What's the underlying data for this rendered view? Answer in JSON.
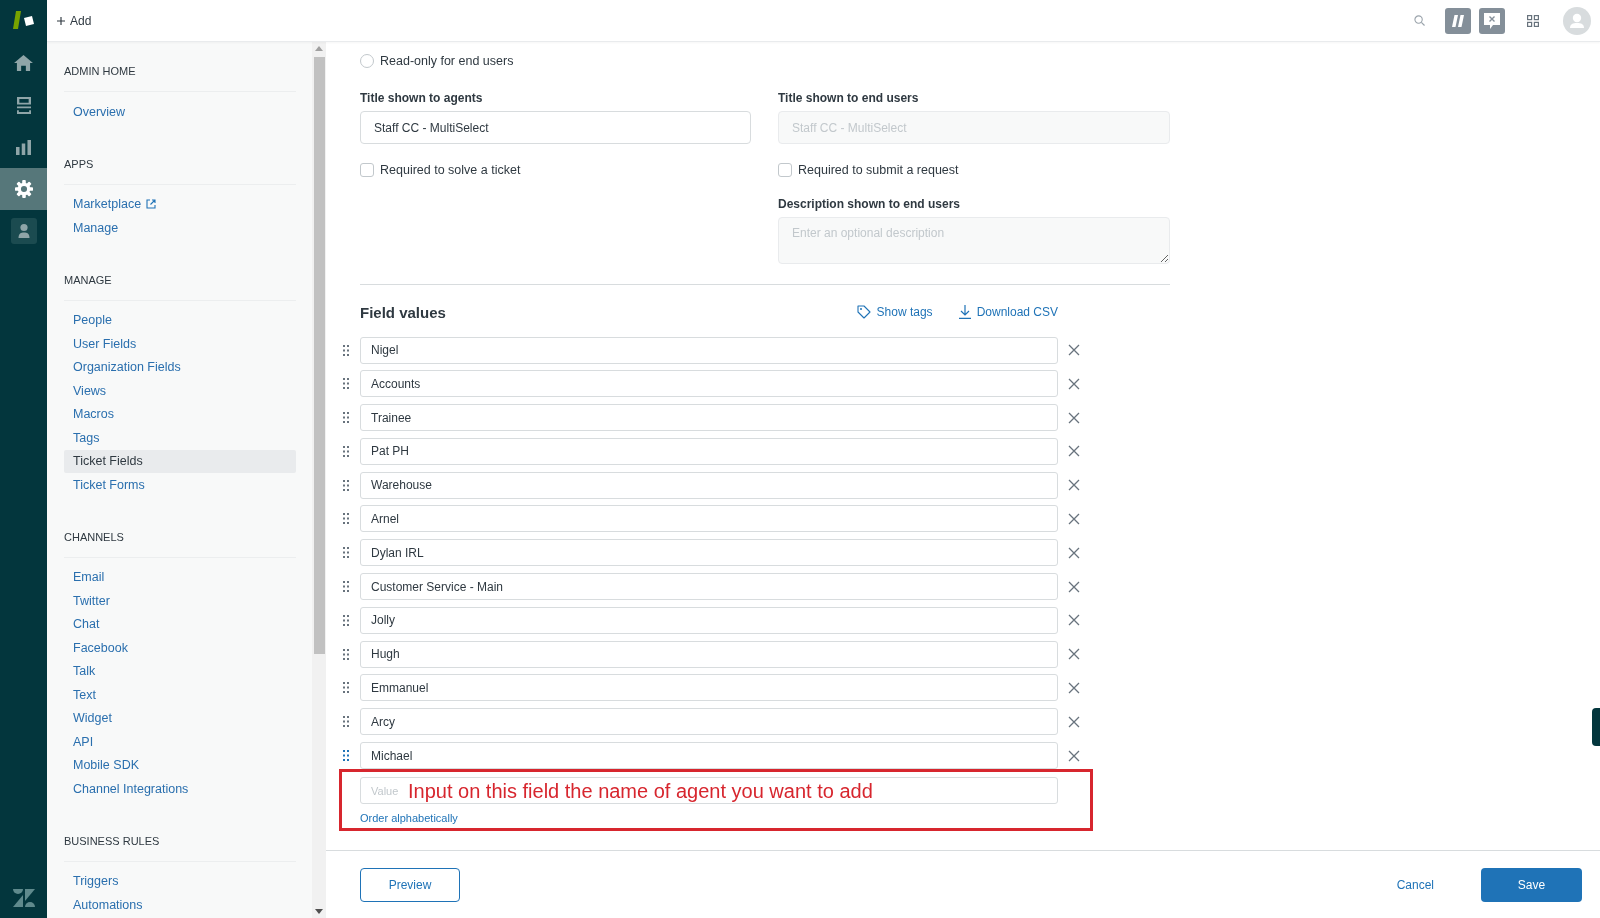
{
  "nav_rail": [
    {
      "selected": false
    },
    {
      "selected": false
    },
    {
      "selected": false
    },
    {
      "selected": true
    },
    {
      "selected": false
    }
  ],
  "top_bar": {
    "add_label": "Add"
  },
  "sidebar": {
    "sections": [
      {
        "title": "ADMIN HOME",
        "items": [
          {
            "label": "Overview",
            "selected": false,
            "external": false
          }
        ]
      },
      {
        "title": "APPS",
        "items": [
          {
            "label": "Marketplace",
            "selected": false,
            "external": true
          },
          {
            "label": "Manage",
            "selected": false,
            "external": false
          }
        ]
      },
      {
        "title": "MANAGE",
        "items": [
          {
            "label": "People",
            "selected": false,
            "external": false
          },
          {
            "label": "User Fields",
            "selected": false,
            "external": false
          },
          {
            "label": "Organization Fields",
            "selected": false,
            "external": false
          },
          {
            "label": "Views",
            "selected": false,
            "external": false
          },
          {
            "label": "Macros",
            "selected": false,
            "external": false
          },
          {
            "label": "Tags",
            "selected": false,
            "external": false
          },
          {
            "label": "Ticket Fields",
            "selected": true,
            "external": false
          },
          {
            "label": "Ticket Forms",
            "selected": false,
            "external": false
          }
        ]
      },
      {
        "title": "CHANNELS",
        "items": [
          {
            "label": "Email",
            "selected": false,
            "external": false
          },
          {
            "label": "Twitter",
            "selected": false,
            "external": false
          },
          {
            "label": "Chat",
            "selected": false,
            "external": false
          },
          {
            "label": "Facebook",
            "selected": false,
            "external": false
          },
          {
            "label": "Talk",
            "selected": false,
            "external": false
          },
          {
            "label": "Text",
            "selected": false,
            "external": false
          },
          {
            "label": "Widget",
            "selected": false,
            "external": false
          },
          {
            "label": "API",
            "selected": false,
            "external": false
          },
          {
            "label": "Mobile SDK",
            "selected": false,
            "external": false
          },
          {
            "label": "Channel Integrations",
            "selected": false,
            "external": false
          }
        ]
      },
      {
        "title": "BUSINESS RULES",
        "items": [
          {
            "label": "Triggers",
            "selected": false,
            "external": false
          },
          {
            "label": "Automations",
            "selected": false,
            "external": false
          }
        ]
      }
    ]
  },
  "form": {
    "radios": [
      {
        "label": "Read-only for end users",
        "selected": false
      }
    ],
    "agent_title": {
      "label": "Title shown to agents",
      "value": "Staff CC - MultiSelect",
      "disabled": false
    },
    "end_user_title": {
      "label": "Title shown to end users",
      "value": "Staff CC - MultiSelect",
      "disabled": true
    },
    "agent_required": {
      "label": "Required to solve a ticket",
      "checked": false
    },
    "end_user_required": {
      "label": "Required to submit a request",
      "checked": false
    },
    "end_user_description": {
      "label": "Description shown to end users",
      "placeholder": "Enter an optional description",
      "disabled": true
    }
  },
  "field_values": {
    "title": "Field values",
    "actions": [
      {
        "kind": "tags",
        "label": "Show tags"
      },
      {
        "kind": "download",
        "label": "Download CSV"
      }
    ],
    "values": [
      {
        "value": "Nigel",
        "hovered": false
      },
      {
        "value": "Accounts",
        "hovered": false
      },
      {
        "value": "Trainee",
        "hovered": false
      },
      {
        "value": "Pat PH",
        "hovered": false
      },
      {
        "value": "Warehouse",
        "hovered": false
      },
      {
        "value": "Arnel",
        "hovered": false
      },
      {
        "value": "Dylan IRL",
        "hovered": false
      },
      {
        "value": "Customer Service - Main",
        "hovered": false
      },
      {
        "value": "Jolly",
        "hovered": false
      },
      {
        "value": "Hugh",
        "hovered": false
      },
      {
        "value": "Emmanuel",
        "hovered": false
      },
      {
        "value": "Arcy",
        "hovered": false
      },
      {
        "value": "Michael",
        "hovered": true
      }
    ],
    "new_value": {
      "placeholder": "Value"
    },
    "order_link": "Order alphabetically"
  },
  "annotation": {
    "text": "Input on this field the name of agent you want to add"
  },
  "footer": {
    "preview": "Preview",
    "cancel": "Cancel",
    "save": "Save"
  }
}
